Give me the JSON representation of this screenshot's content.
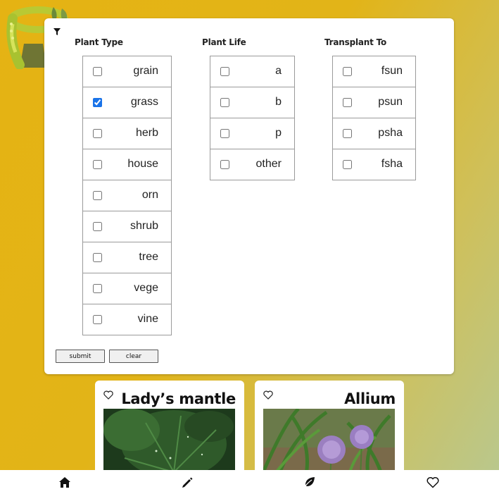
{
  "filter": {
    "groups": [
      {
        "title": "Plant Type",
        "options": [
          {
            "label": "grain",
            "checked": false
          },
          {
            "label": "grass",
            "checked": true
          },
          {
            "label": "herb",
            "checked": false
          },
          {
            "label": "house",
            "checked": false
          },
          {
            "label": "orn",
            "checked": false
          },
          {
            "label": "shrub",
            "checked": false
          },
          {
            "label": "tree",
            "checked": false
          },
          {
            "label": "vege",
            "checked": false
          },
          {
            "label": "vine",
            "checked": false
          }
        ]
      },
      {
        "title": "Plant Life",
        "options": [
          {
            "label": "a",
            "checked": false
          },
          {
            "label": "b",
            "checked": false
          },
          {
            "label": "p",
            "checked": false
          },
          {
            "label": "other",
            "checked": false
          }
        ]
      },
      {
        "title": "Transplant To",
        "options": [
          {
            "label": "fsun",
            "checked": false
          },
          {
            "label": "psun",
            "checked": false
          },
          {
            "label": "psha",
            "checked": false
          },
          {
            "label": "fsha",
            "checked": false
          }
        ]
      }
    ],
    "submit_label": "submit",
    "clear_label": "clear"
  },
  "cards": [
    {
      "title": "Lady’s mantle",
      "favorite": false
    },
    {
      "title": "Allium",
      "favorite": false
    }
  ],
  "nav": {
    "items": [
      "home-icon",
      "pencil-icon",
      "leaf-icon",
      "heart-icon"
    ]
  },
  "colors": {
    "background_start": "#e5b313",
    "background_end": "#b8c890",
    "checkbox_accent": "#1a73e8"
  }
}
